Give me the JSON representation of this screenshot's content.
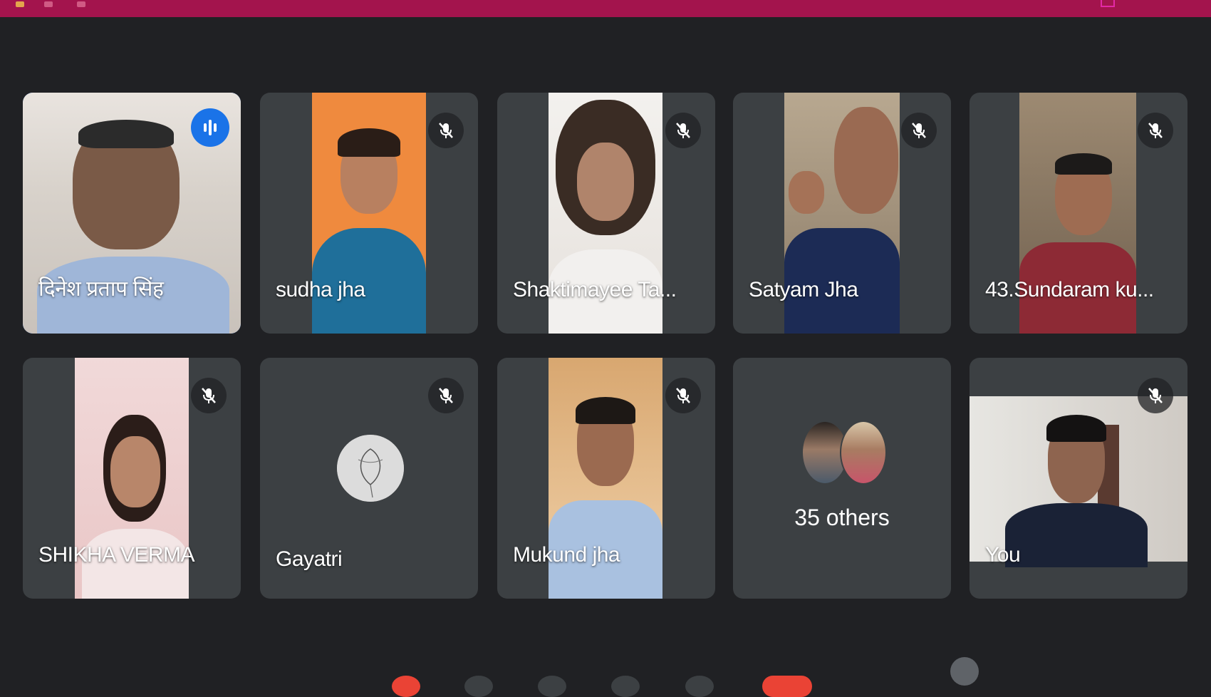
{
  "meeting": {
    "accent_color": "#1a73e8",
    "top_bar_color": "#a3144d"
  },
  "participants": [
    {
      "name": "दिनेश प्रताप सिंह",
      "status": "speaking",
      "icon": "speaking-indicator-icon"
    },
    {
      "name": "sudha jha",
      "status": "muted",
      "icon": "mic-off-icon"
    },
    {
      "name": "Shaktimayee Ta...",
      "status": "muted",
      "icon": "mic-off-icon"
    },
    {
      "name": "Satyam Jha",
      "status": "muted",
      "icon": "mic-off-icon"
    },
    {
      "name": "43.Sundaram ku...",
      "status": "muted",
      "icon": "mic-off-icon"
    },
    {
      "name": "SHIKHA VERMA",
      "status": "muted",
      "icon": "mic-off-icon"
    },
    {
      "name": "Gayatri",
      "status": "muted",
      "icon": "mic-off-icon"
    },
    {
      "name": "Mukund jha",
      "status": "muted",
      "icon": "mic-off-icon"
    },
    {
      "name": "You",
      "status": "muted",
      "icon": "mic-off-icon"
    }
  ],
  "others": {
    "label": "35 others"
  }
}
